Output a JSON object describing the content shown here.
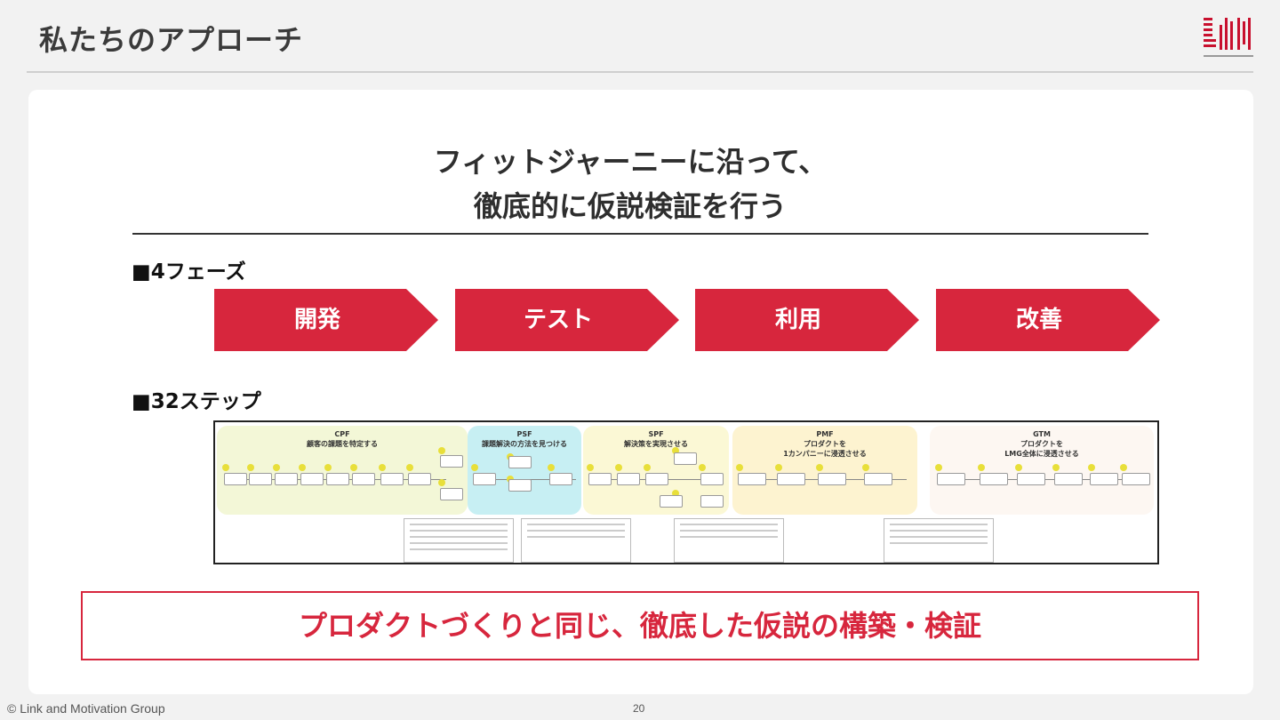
{
  "header": {
    "title": "私たちのアプローチ"
  },
  "headline": {
    "line1": "フィットジャーニーに沿って、",
    "line2": "徹底的に仮説検証を行う"
  },
  "phases_section": {
    "label": "■4フェーズ",
    "phases": [
      "開発",
      "テスト",
      "利用",
      "改善"
    ],
    "color": "#d7263d"
  },
  "steps_section": {
    "label": "■32ステップ",
    "stages": [
      {
        "code": "CPF",
        "title": "顧客の課題を特定する",
        "color": "#f3f7d7"
      },
      {
        "code": "PSF",
        "title": "課題解決の方法を見つける",
        "color": "#c7eff3"
      },
      {
        "code": "SPF",
        "title": "解決策を実現させる",
        "color": "#fbf8d5"
      },
      {
        "code": "PMF",
        "title_line1": "プロダクトを",
        "title_line2": "1カンパニーに浸透させる",
        "color": "#fdf3d0"
      },
      {
        "code": "GTM",
        "title_line1": "プロダクトを",
        "title_line2": "LMG全体に浸透させる",
        "color": "#fdf7f2"
      }
    ]
  },
  "bottom_message": "プロダクトづくりと同じ、徹底した仮説の構築・検証",
  "footer": {
    "copyright": "© Link and Motivation Group",
    "page": "20"
  }
}
